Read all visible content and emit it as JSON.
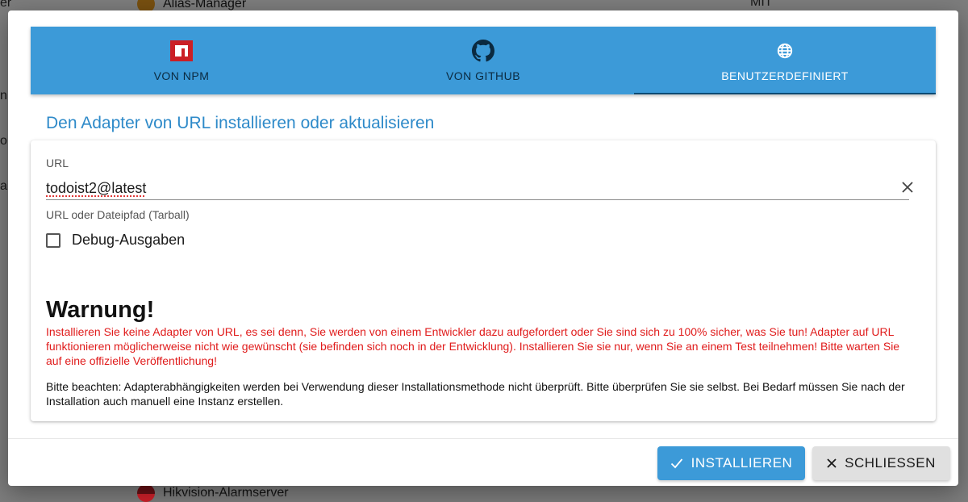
{
  "background": {
    "top_item": "Alias-Manager",
    "bottom_item": "Hikvision-Alarmserver",
    "left_fragments": [
      "er",
      "n",
      "o",
      "ai"
    ],
    "top_right_text": "MIT"
  },
  "tabs": [
    {
      "label": "VON NPM",
      "icon": "npm-icon",
      "active": false
    },
    {
      "label": "VON GITHUB",
      "icon": "github-icon",
      "active": false
    },
    {
      "label": "BENUTZERDEFINIERT",
      "icon": "globe-icon",
      "active": true
    }
  ],
  "heading": "Den Adapter von URL installieren oder aktualisieren",
  "form": {
    "url_label": "URL",
    "url_value": "todoist2@latest",
    "helper_text": "URL oder Dateipfad (Tarball)",
    "debug_label": "Debug-Ausgaben",
    "debug_checked": false
  },
  "warning": {
    "title": "Warnung!",
    "text": "Installieren Sie keine Adapter von URL, es sei denn, Sie werden von einem Entwickler dazu aufgefordert oder Sie sind sich zu 100% sicher, was Sie tun! Adapter auf URL funktionieren möglicherweise nicht wie gewünscht (sie befinden sich noch in der Entwicklung). Installieren Sie sie nur, wenn Sie an einem Test teilnehmen! Bitte warten Sie auf eine offizielle Veröffentlichung!",
    "note": "Bitte beachten: Adapterabhängigkeiten werden bei Verwendung dieser Installationsmethode nicht überprüft. Bitte überprüfen Sie sie selbst. Bei Bedarf müssen Sie nach der Installation auch manuell eine Instanz erstellen."
  },
  "buttons": {
    "install_label": "INSTALLIEREN",
    "close_label": "SCHLIESSEN"
  },
  "colors": {
    "accent": "#3c9ad8",
    "heading": "#2e8ac9",
    "warning": "#e01b1b",
    "npm_red": "#cb1f25"
  }
}
